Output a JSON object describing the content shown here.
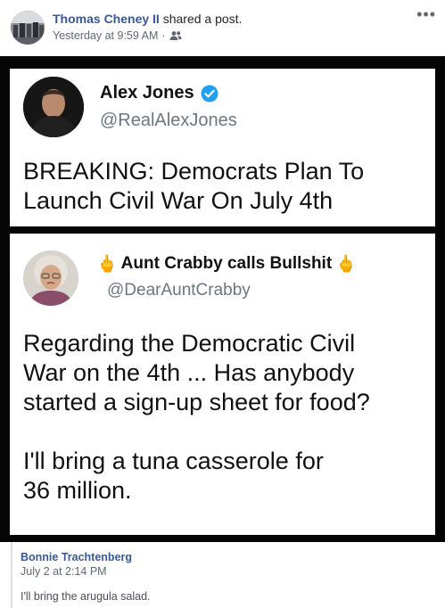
{
  "post": {
    "author": "Thomas Cheney II",
    "action": "shared a post.",
    "timestamp": "Yesterday at 9:59 AM",
    "separator": "·",
    "audience_icon": "friends-icon",
    "more_label": "•••"
  },
  "shared_image": {
    "tweet1": {
      "name": "Alex Jones",
      "handle": "@RealAlexJones",
      "verified": true,
      "body": "BREAKING: Democrats Plan To\nLaunch Civil War On July 4th"
    },
    "tweet2": {
      "name": "Aunt Crabby calls Bullshit",
      "finger_emoji": "🖕",
      "handle": "@DearAuntCrabby",
      "body": "Regarding the Democratic Civil\nWar on the 4th ... Has anybody\nstarted a sign-up sheet for food?\n\nI'll bring a tuna casserole for\n36 million."
    }
  },
  "comment": {
    "author": "Bonnie Trachtenberg",
    "timestamp": "July 2 at 2:14 PM",
    "text": "I'll bring the arugula salad."
  },
  "colors": {
    "link": "#385898",
    "verified": "#1da1f2",
    "meta": "#616770"
  }
}
